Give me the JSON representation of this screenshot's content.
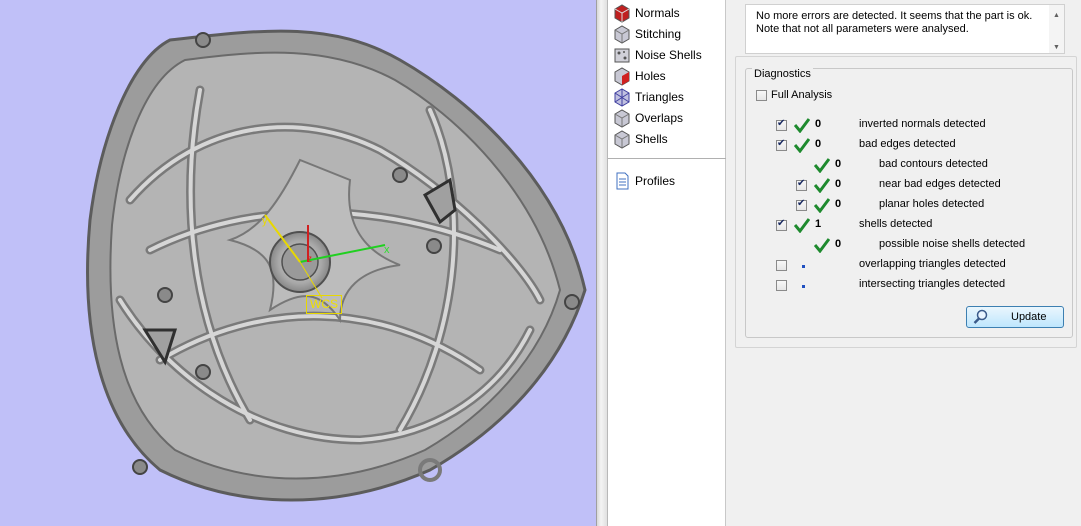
{
  "viewport": {
    "wcs_label": "WCS",
    "axis_x": "x",
    "axis_y": "y",
    "axis_z": "z"
  },
  "tools": [
    {
      "label": "Normals",
      "icon": "normals-icon"
    },
    {
      "label": "Stitching",
      "icon": "stitching-icon"
    },
    {
      "label": "Noise Shells",
      "icon": "noise-shells-icon"
    },
    {
      "label": "Holes",
      "icon": "holes-icon"
    },
    {
      "label": "Triangles",
      "icon": "triangles-icon"
    },
    {
      "label": "Overlaps",
      "icon": "overlaps-icon"
    },
    {
      "label": "Shells",
      "icon": "shells-icon"
    },
    {
      "label": "Profiles",
      "icon": "profiles-icon"
    }
  ],
  "message": {
    "line1": "No more errors are detected. It seems that the part is ok.",
    "line2": "Note that not all parameters were analysed."
  },
  "diagnostics": {
    "title": "Diagnostics",
    "full_analysis": {
      "label": "Full Analysis",
      "checked": false
    },
    "rows": [
      {
        "count": "0",
        "label": "inverted normals detected",
        "checked": true,
        "status": "ok"
      },
      {
        "count": "0",
        "label": "bad edges detected",
        "checked": true,
        "status": "ok"
      },
      {
        "count": "0",
        "label": "bad contours detected",
        "checked": null,
        "status": "ok"
      },
      {
        "count": "0",
        "label": "near bad edges detected",
        "checked": true,
        "status": "ok"
      },
      {
        "count": "0",
        "label": "planar holes detected",
        "checked": true,
        "status": "ok"
      },
      {
        "count": "1",
        "label": "shells detected",
        "checked": true,
        "status": "ok"
      },
      {
        "count": "0",
        "label": "possible noise shells detected",
        "checked": null,
        "status": "ok"
      },
      {
        "count": "",
        "label": "overlapping triangles detected",
        "checked": false,
        "status": "pending"
      },
      {
        "count": "",
        "label": "intersecting triangles detected",
        "checked": false,
        "status": "pending"
      }
    ],
    "update_label": "Update"
  },
  "colors": {
    "viewport_bg": "#c0c0f8",
    "check_green": "#1e8a2e",
    "accent_blue": "#3c7fb1"
  }
}
